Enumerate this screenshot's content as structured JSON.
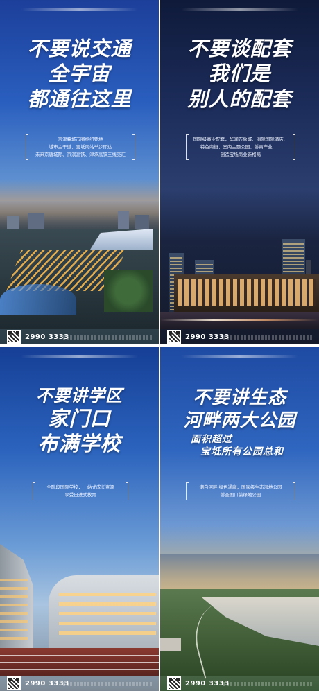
{
  "posters": [
    {
      "headline": [
        "不要说交通",
        "全宇宙",
        "都通往这里"
      ],
      "info": [
        "京津冀城市圈枢纽要地",
        "城市主干道，宝坻南站举步即达",
        "未来京唐城际、京滨高铁、津承高铁三线交汇"
      ],
      "phone": "2990 3333",
      "scene": "railway-station-night"
    },
    {
      "headline": [
        "不要谈配套",
        "我们是",
        "别人的配套"
      ],
      "info": [
        "国际级商业配套，华润万象城、洲际国际酒店、",
        "特色商街、室内主题公园、侨商产业......",
        "创造宝坻商业新格局"
      ],
      "phone": "2990 3333",
      "scene": "commercial-towers-night"
    },
    {
      "headline": [
        "不要讲学区",
        "家门口",
        "布满学校"
      ],
      "info": [
        "全阶段国际学校，一站式成长资源",
        "享受日进式教育"
      ],
      "phone": "2990 3333",
      "scene": "school-campus"
    },
    {
      "headline": [
        "不要讲生态",
        "河畔两大公园"
      ],
      "subheadline": [
        "面积超过",
        "宝坻所有公园总和"
      ],
      "info": [
        "潮白河畔 绿色通廊，国家级生态湿地公园",
        "侨圣图口袋绿地公园"
      ],
      "phone": "2990 3333",
      "scene": "riverside-park"
    }
  ]
}
